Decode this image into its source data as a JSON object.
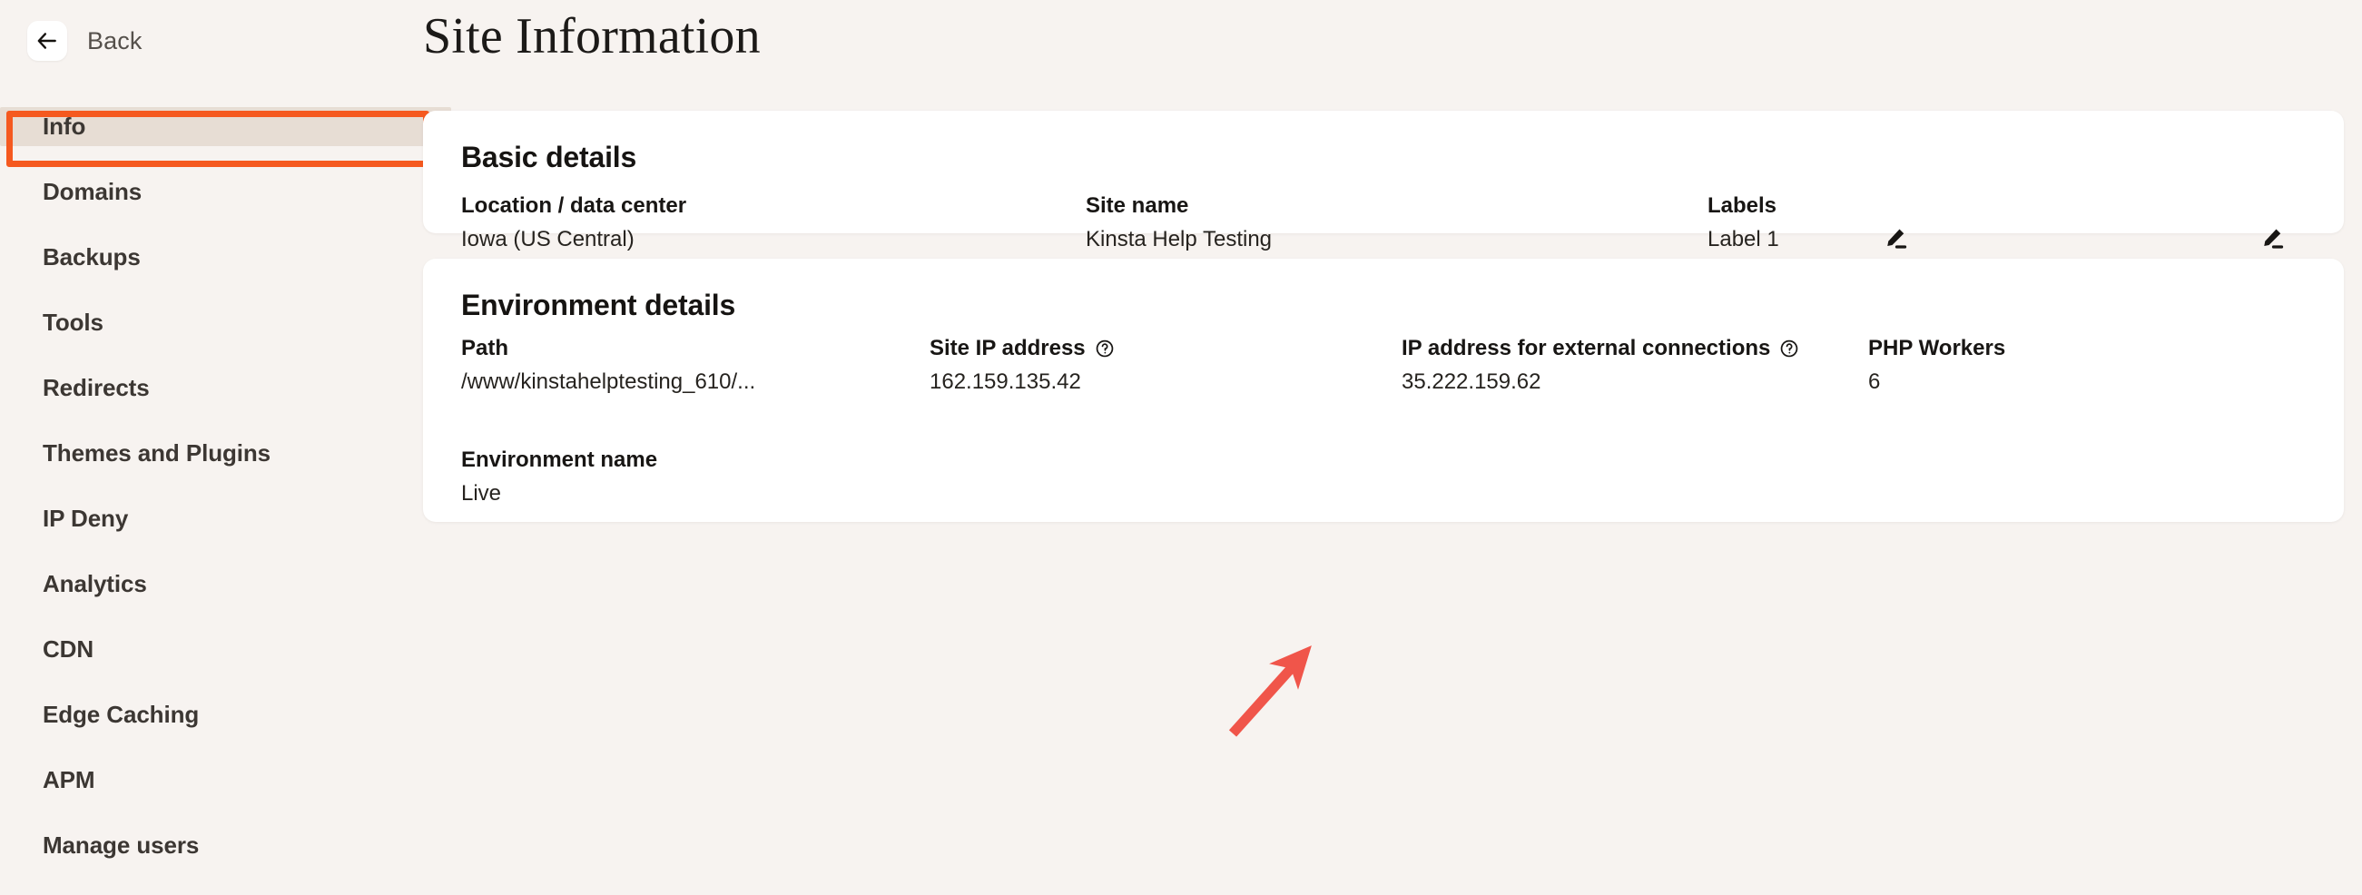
{
  "sidebar": {
    "back": {
      "label": "Back",
      "icon": "arrow-left-icon"
    },
    "items": [
      {
        "label": "Info",
        "active": true
      },
      {
        "label": "Domains",
        "active": false
      },
      {
        "label": "Backups",
        "active": false
      },
      {
        "label": "Tools",
        "active": false
      },
      {
        "label": "Redirects",
        "active": false
      },
      {
        "label": "Themes and Plugins",
        "active": false
      },
      {
        "label": "IP Deny",
        "active": false
      },
      {
        "label": "Analytics",
        "active": false
      },
      {
        "label": "CDN",
        "active": false
      },
      {
        "label": "Edge Caching",
        "active": false
      },
      {
        "label": "APM",
        "active": false
      },
      {
        "label": "Manage users",
        "active": false
      }
    ]
  },
  "header": {
    "title": "Site Information"
  },
  "basic_details": {
    "title": "Basic details",
    "fields": {
      "location_label": "Location / data center",
      "location_value": "Iowa (US Central)",
      "site_name_label": "Site name",
      "site_name_value": "Kinsta Help Testing",
      "labels_label": "Labels",
      "labels_value": "Label 1"
    }
  },
  "environment_details": {
    "title": "Environment details",
    "fields": {
      "path_label": "Path",
      "path_value": "/www/kinstahelptesting_610/...",
      "site_ip_label": "Site IP address",
      "site_ip_value": "162.159.135.42",
      "external_ip_label": "IP address for external connections",
      "external_ip_value": "35.222.159.62",
      "php_workers_label": "PHP Workers",
      "php_workers_value": "6",
      "env_name_label": "Environment name",
      "env_name_value": "Live"
    }
  },
  "annotations": {
    "highlight_color": "#F5591F",
    "arrow_color": "#F0554A",
    "highlight_target": "Info",
    "arrow_target": "35.222.159.62"
  },
  "colors": {
    "page_background": "#F7F3F0",
    "card_background": "#FFFFFF",
    "active_nav_background": "#E7DDD4",
    "text_primary": "#2E2A26"
  }
}
